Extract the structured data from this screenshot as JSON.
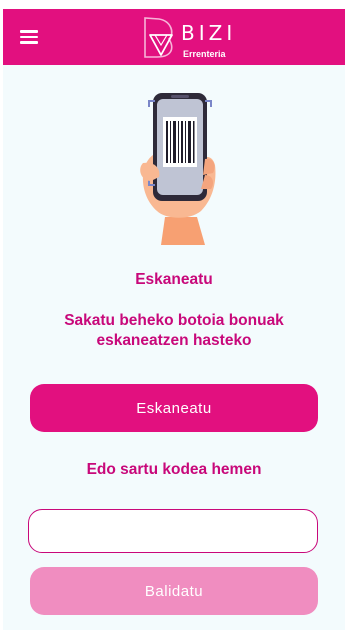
{
  "header": {
    "logo_name": "BIZI",
    "logo_subtitle": "Errenteria",
    "menu_icon": "hamburger-menu-icon"
  },
  "illustration": {
    "icon": "hand-phone-barcode-icon"
  },
  "main": {
    "title": "Eskaneatu",
    "instructions": "Sakatu beheko botoia bonuak eskaneatzen hasteko",
    "scan_button_label": "Eskaneatu",
    "code_label": "Edo sartu kodea hemen",
    "code_value": "",
    "validate_button_label": "Balidatu"
  },
  "colors": {
    "brand": "#e2107f",
    "text_accent": "#c8087a",
    "button_disabled": "#f08dc0",
    "background": "#f3fbfd"
  }
}
